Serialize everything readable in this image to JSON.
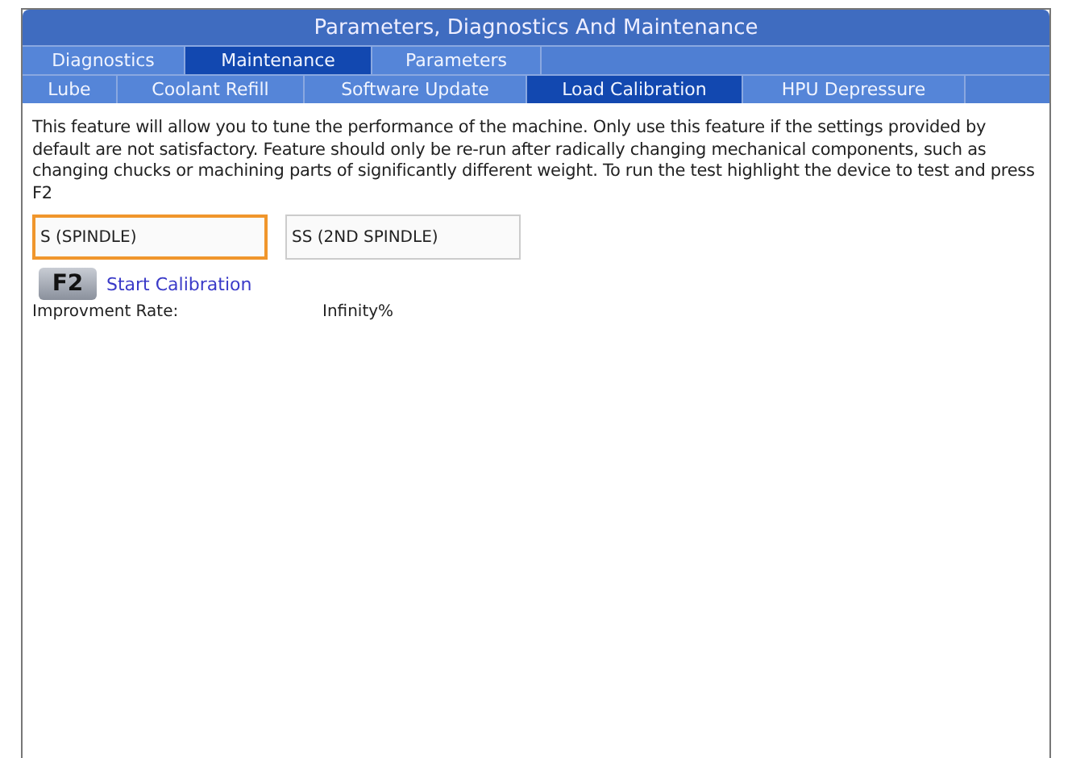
{
  "window": {
    "title": "Parameters, Diagnostics And Maintenance"
  },
  "tabs": [
    {
      "label": "Diagnostics",
      "selected": false
    },
    {
      "label": "Maintenance",
      "selected": true
    },
    {
      "label": "Parameters",
      "selected": false
    }
  ],
  "subtabs": [
    {
      "label": "Lube",
      "selected": false
    },
    {
      "label": "Coolant Refill",
      "selected": false
    },
    {
      "label": "Software Update",
      "selected": false
    },
    {
      "label": "Load Calibration",
      "selected": true
    },
    {
      "label": "HPU Depressure",
      "selected": false
    }
  ],
  "description": "This feature will allow you to tune the performance of the machine. Only use this feature if the settings provided by default are not satisfactory. Feature should only be re-run after radically changing mechanical components, such as changing chucks or machining parts of significantly different weight. To run the test highlight the device to test and press F2",
  "devices": [
    {
      "label": "S (SPINDLE)",
      "selected": true
    },
    {
      "label": "SS (2ND SPINDLE)",
      "selected": false
    }
  ],
  "action": {
    "key": "F2",
    "label": "Start Calibration"
  },
  "result": {
    "label": "Improvment Rate:",
    "value": "Infinity%"
  }
}
